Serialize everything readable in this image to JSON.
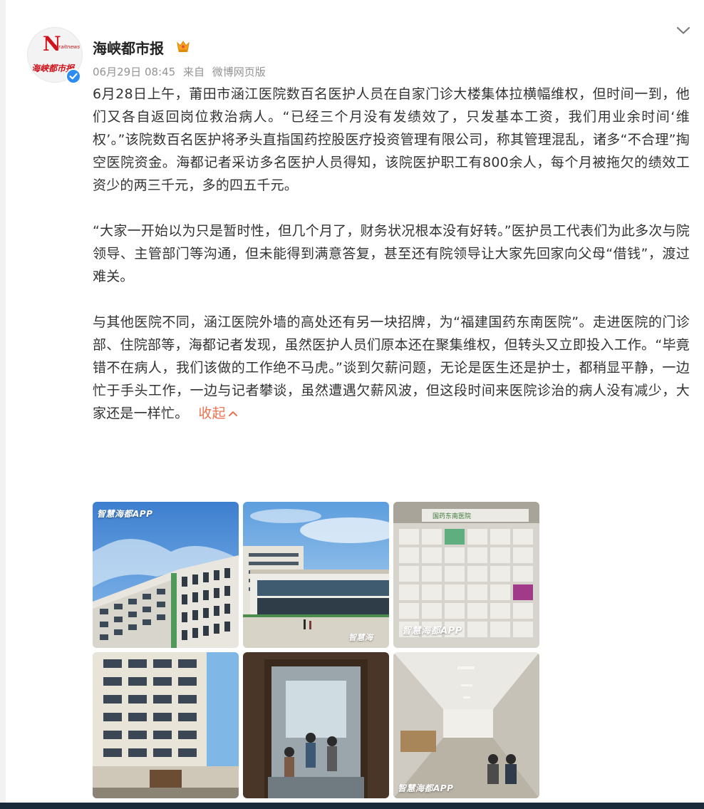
{
  "author": {
    "name": "海峡都市报",
    "avatar_letter": "N",
    "avatar_sub": "Straitnews",
    "avatar_brand": "海峡都市报"
  },
  "meta": {
    "time": "06月29日 08:45",
    "source_prefix": "来自",
    "source": "微博网页版"
  },
  "post": {
    "paragraphs": [
      "6月28日上午，莆田市涵江医院数百名医护人员在自家门诊大楼集体拉横幅维权，但时间一到，他们又各自返回岗位救治病人。“已经三个月没有发绩效了，只发基本工资，我们用业余时间‘维权’。”该院数百名医护将矛头直指国药控股医疗投资管理有限公司，称其管理混乱，诸多“不合理”掏空医院资金。海都记者采访多名医护人员得知，该院医护职工有800余人，每个月被拖欠的绩效工资少的两三千元，多的四五千元。",
      "“大家一开始以为只是暂时性，但几个月了，财务状况根本没有好转。”医护员工代表们为此多次与院领导、主管部门等沟通，但未能得到满意答复，甚至还有院领导让大家先回家向父母“借钱”，渡过难关。",
      "与其他医院不同，涵江医院外墙的高处还有另一块招牌，为“福建国药东南医院”。走进医院的门诊部、住院部等，海都记者发现，虽然医护人员们原本还在聚集维权，但转头又立即投入工作。“毕竟错不在病人，我们该做的工作绝不马虎。”谈到欠薪问题，无论是医生还是护士，都稍显平静，一边忙于手头工作，一边与记者攀谈，虽然遭遇欠薪风波，但这段时间来医院诊治的病人没有减少，大家还是一样忙。"
    ],
    "collapse_label": "收起",
    "collapse_caret": "^"
  },
  "images": {
    "watermark": "智慧海都APP",
    "watermark_short": "智慧海",
    "sign_text": "国药东南医院"
  },
  "colors": {
    "accent": "#eb7350",
    "verified": "#2d8cf0",
    "brand_red": "#d0121b"
  }
}
